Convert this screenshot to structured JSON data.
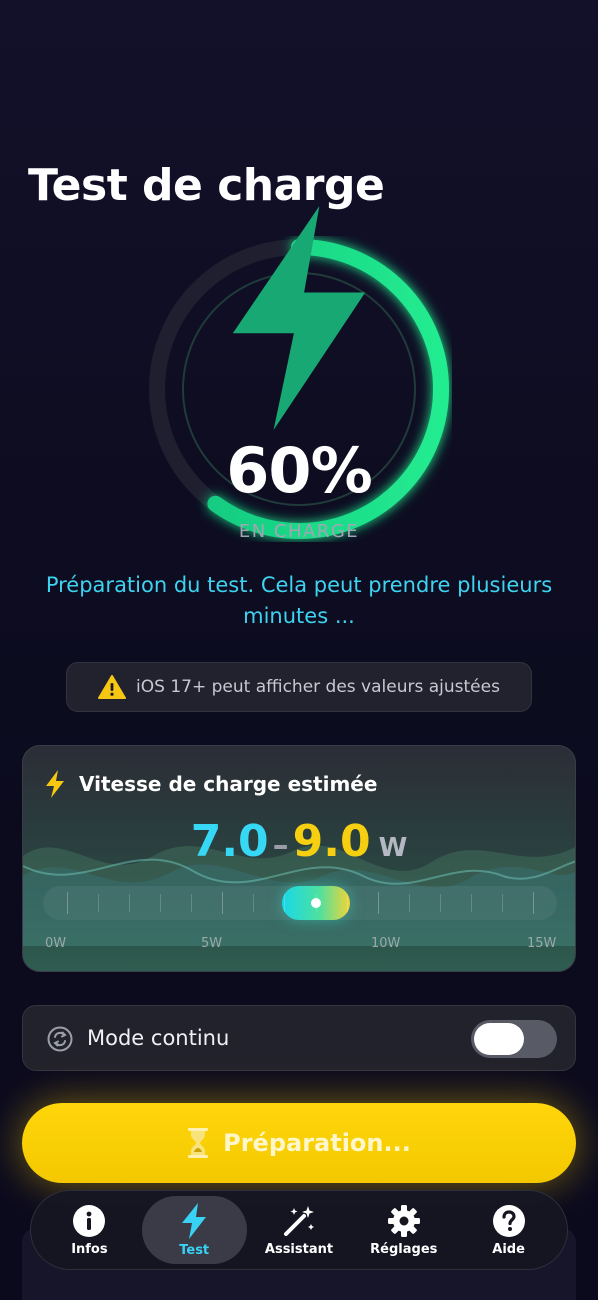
{
  "page": {
    "title": "Test de charge"
  },
  "gauge": {
    "percent_text": "60%",
    "label": "EN CHARGE",
    "progress": 0.6,
    "color": "#1fe08a"
  },
  "status": {
    "message": "Préparation du test. Cela peut prendre plusieurs minutes ..."
  },
  "warning": {
    "text": "iOS 17+ peut afficher des valeurs ajustées"
  },
  "speed_card": {
    "title": "Vitesse de charge estimée",
    "low": "7.0",
    "dash": "–",
    "high": "9.0",
    "unit": "W",
    "range_w": [
      7.0,
      9.0
    ],
    "scale_max_w": 15,
    "scale_labels": [
      "0W",
      "5W",
      "10W",
      "15W"
    ]
  },
  "mode": {
    "label": "Mode continu",
    "enabled": false
  },
  "cta": {
    "label": "Préparation..."
  },
  "tabs": [
    {
      "label": "Infos",
      "icon": "info-icon",
      "active": false
    },
    {
      "label": "Test",
      "icon": "bolt-icon",
      "active": true
    },
    {
      "label": "Assistant",
      "icon": "magic-wand-icon",
      "active": false
    },
    {
      "label": "Réglages",
      "icon": "gear-icon",
      "active": false
    },
    {
      "label": "Aide",
      "icon": "help-icon",
      "active": false
    }
  ],
  "colors": {
    "accent_cyan": "#38d2f5",
    "accent_yellow": "#ffd60a",
    "accent_green": "#1fe08a"
  }
}
